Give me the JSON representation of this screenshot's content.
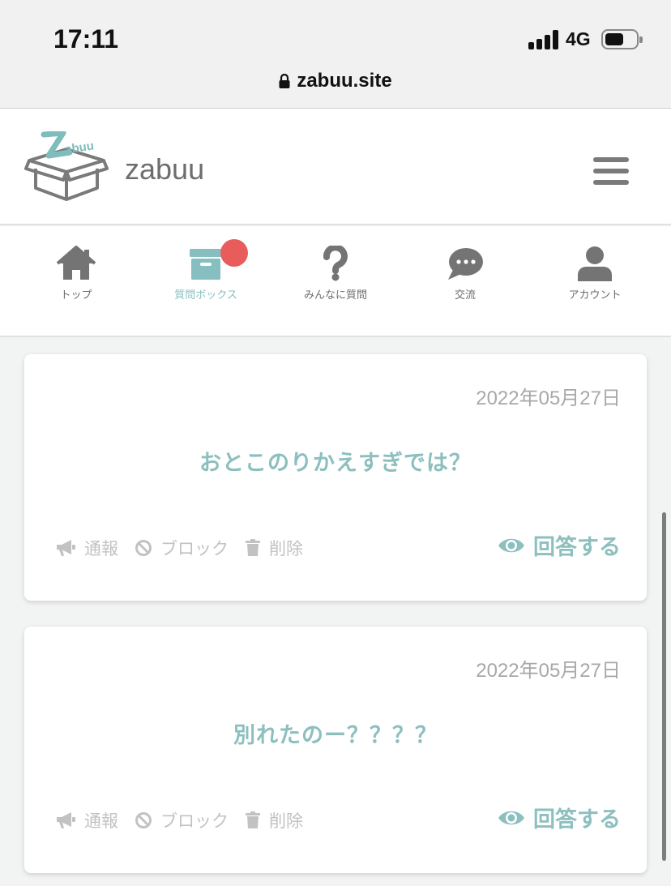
{
  "status_bar": {
    "time": "17:11",
    "network": "4G",
    "battery_level": 0.6
  },
  "browser": {
    "url": "zabuu.site"
  },
  "header": {
    "site_name": "zabuu",
    "logo_text": "Zabuu"
  },
  "nav": {
    "items": [
      {
        "label": "トップ",
        "icon": "home-icon",
        "active": false
      },
      {
        "label": "質問ボックス",
        "icon": "box-icon",
        "active": true
      },
      {
        "label": "みんなに質問",
        "icon": "question-icon",
        "active": false
      },
      {
        "label": "交流",
        "icon": "chat-icon",
        "active": false
      },
      {
        "label": "アカウント",
        "icon": "user-icon",
        "active": false
      }
    ]
  },
  "cards": [
    {
      "date": "2022年05月27日",
      "question": "おとこのりかえすぎでは？",
      "report_label": "通報",
      "block_label": "ブロック",
      "delete_label": "削除",
      "answer_label": "回答する"
    },
    {
      "date": "2022年05月27日",
      "question": "別れたのー？？？？",
      "report_label": "通報",
      "block_label": "ブロック",
      "delete_label": "削除",
      "answer_label": "回答する"
    }
  ],
  "colors": {
    "accent": "#8dbfbf",
    "badge": "#e85c5c",
    "muted": "#c2c2c2"
  }
}
